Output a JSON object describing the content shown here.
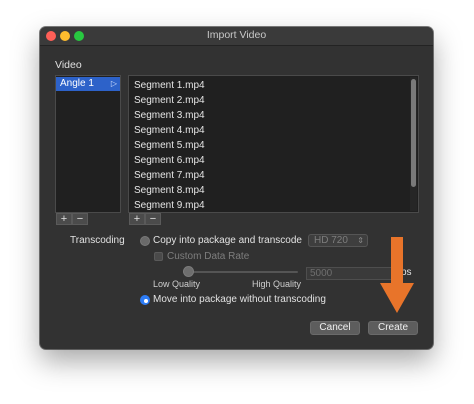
{
  "window": {
    "title": "Import Video"
  },
  "video": {
    "section_label": "Video",
    "angles": [
      {
        "label": "Angle 1",
        "selected": true
      }
    ],
    "segments": [
      "Segment 1.mp4",
      "Segment 2.mp4",
      "Segment 3.mp4",
      "Segment 4.mp4",
      "Segment 5.mp4",
      "Segment 6.mp4",
      "Segment 7.mp4",
      "Segment 8.mp4",
      "Segment 9.mp4"
    ],
    "add_label": "+",
    "remove_label": "−"
  },
  "transcoding": {
    "label": "Transcoding",
    "copy_option": "Copy into package and transcode",
    "copy_selected": false,
    "format_value": "HD 720",
    "custom_data_rate_label": "Custom Data Rate",
    "custom_data_rate_checked": false,
    "quality_low_label": "Low Quality",
    "quality_high_label": "High Quality",
    "quality_level": 0.0,
    "data_rate_value": "5000",
    "data_rate_unit_suffix": "ps",
    "move_option": "Move into package without transcoding",
    "move_selected": true
  },
  "buttons": {
    "cancel_label": "Cancel",
    "create_label": "Create"
  },
  "annotation": {
    "arrow_color": "#e8742a"
  },
  "colors": {
    "window_bg": "#323232",
    "selection_blue": "#2d62c9",
    "radio_blue": "#2d7cf6"
  }
}
